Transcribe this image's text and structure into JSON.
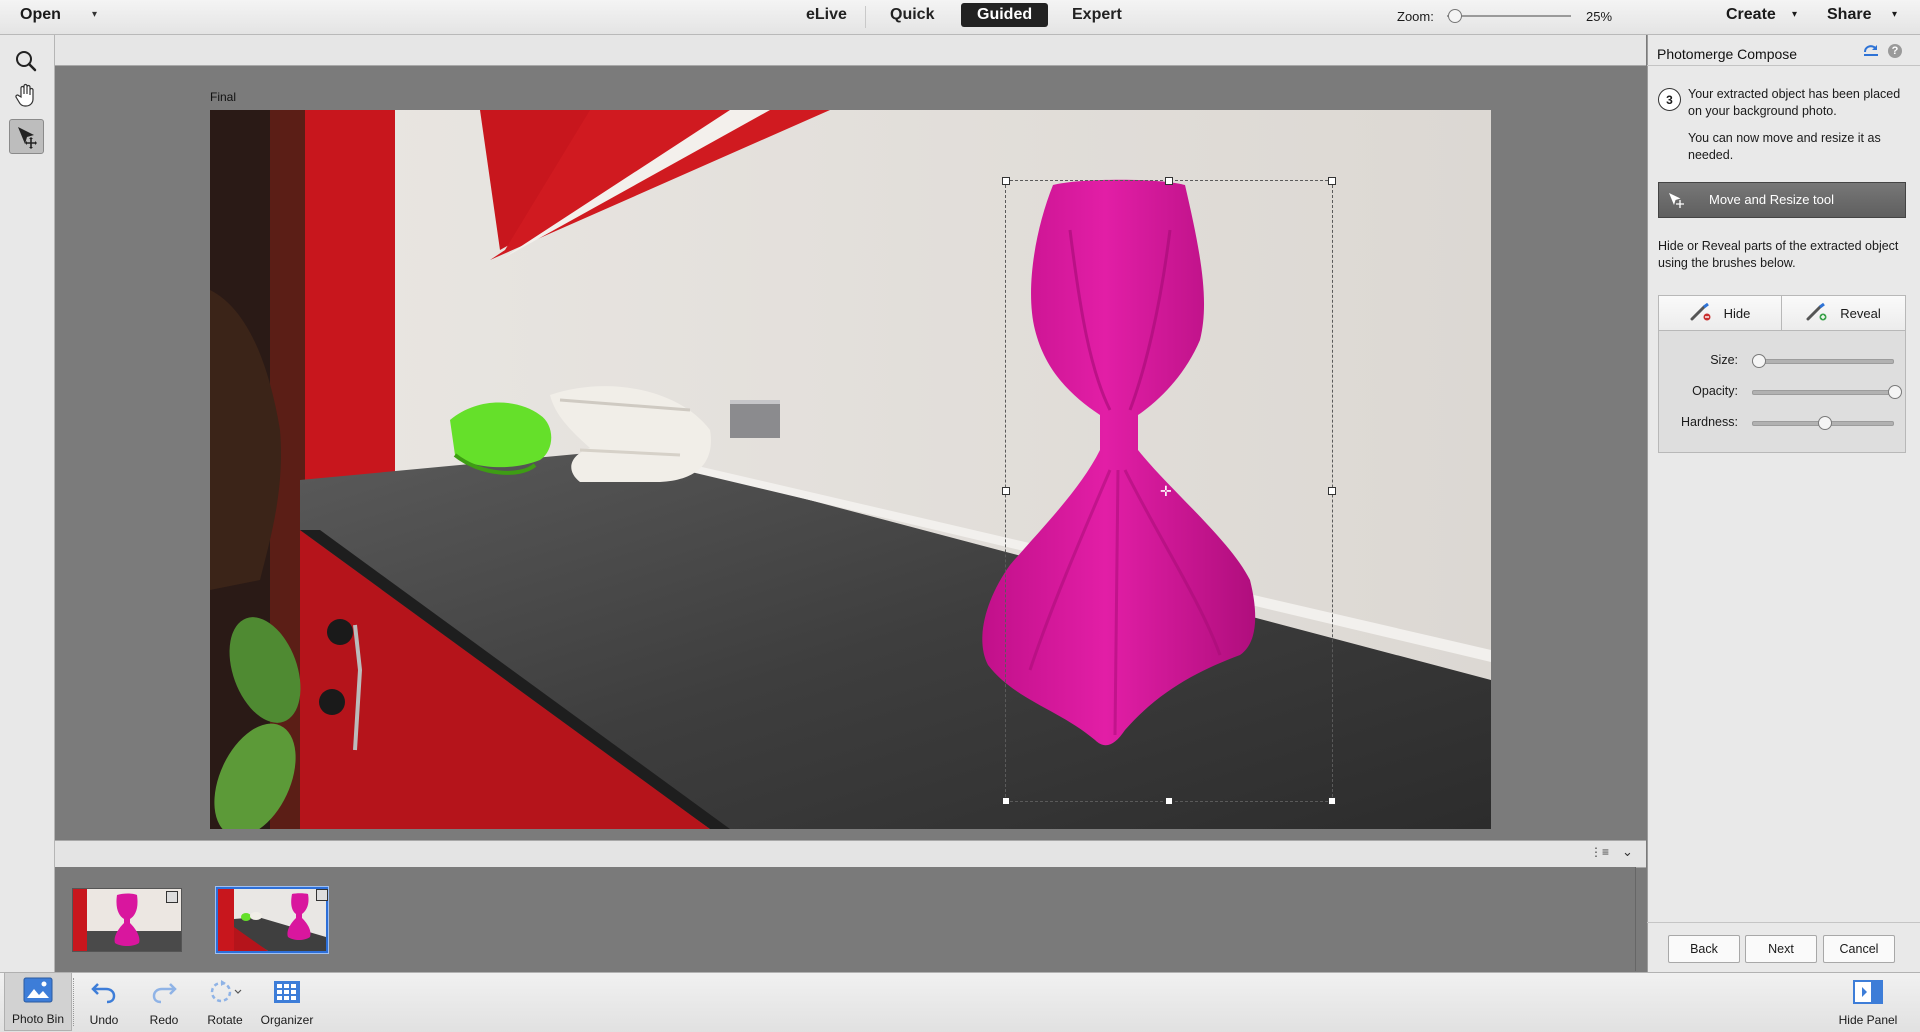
{
  "topbar": {
    "open_label": "Open",
    "modes": [
      "eLive",
      "Quick",
      "Guided",
      "Expert"
    ],
    "active_mode": "Guided",
    "create_label": "Create",
    "share_label": "Share"
  },
  "canvas": {
    "zoom_label": "Zoom:",
    "zoom_value": "25%",
    "zoom_level_fraction": 0.02,
    "image_label": "Final"
  },
  "bottombar": {
    "photo_bin": "Photo Bin",
    "undo": "Undo",
    "redo": "Redo",
    "rotate": "Rotate",
    "organizer": "Organizer",
    "hide_panel": "Hide Panel"
  },
  "panel": {
    "title": "Photomerge Compose",
    "step_number": "3",
    "step_text_1": "Your extracted object has been placed on your background photo.",
    "step_text_2": "You can now move and resize it as needed.",
    "move_resize_tool": "Move and Resize tool",
    "hide_reveal_text": "Hide or Reveal parts of the extracted object using the brushes below.",
    "hide_label": "Hide",
    "reveal_label": "Reveal",
    "size_label": "Size:",
    "opacity_label": "Opacity:",
    "hardness_label": "Hardness:",
    "size_value": 0.0,
    "opacity_value": 1.0,
    "hardness_value": 0.5,
    "back_label": "Back",
    "next_label": "Next",
    "cancel_label": "Cancel"
  },
  "colors": {
    "accent_selected": "#2d6fd8",
    "vase": "#d9169e",
    "booth_red": "#c8161d"
  }
}
